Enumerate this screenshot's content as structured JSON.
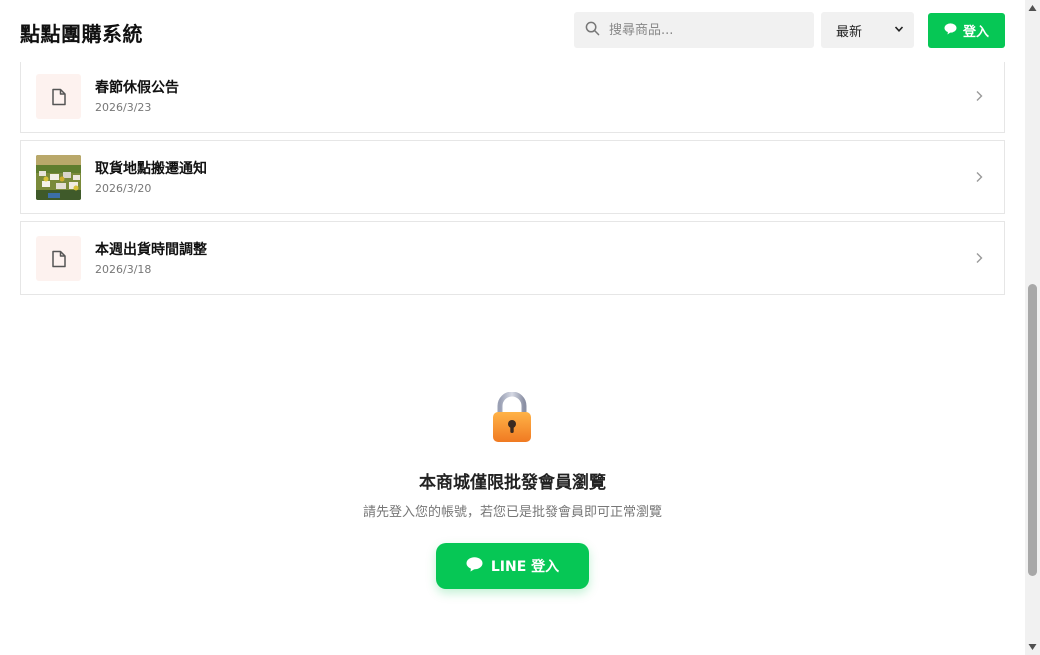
{
  "header": {
    "brand": "點點團購系統",
    "search_placeholder": "搜尋商品...",
    "search_icon": "search-icon",
    "sort_selected": "最新",
    "login_label": "登入",
    "login_icon": "chat-bubble-icon"
  },
  "announcements": [
    {
      "title": "春節休假公告",
      "date": "2026/3/23",
      "thumb": "document-icon"
    },
    {
      "title": "取貨地點搬遷通知",
      "date": "2026/3/20",
      "thumb": "photo-thumbnail"
    },
    {
      "title": "本週出貨時間調整",
      "date": "2026/3/18",
      "thumb": "document-icon"
    }
  ],
  "locked": {
    "icon": "lock-icon",
    "title": "本商城僅限批發會員瀏覽",
    "subtitle": "請先登入您的帳號，若您已是批發會員即可正常瀏覽",
    "line_button_label": "LINE 登入"
  },
  "colors": {
    "accent_green": "#06c755",
    "thumb_bg": "#fdf2ef",
    "lock_orange": "#f28a2e"
  }
}
